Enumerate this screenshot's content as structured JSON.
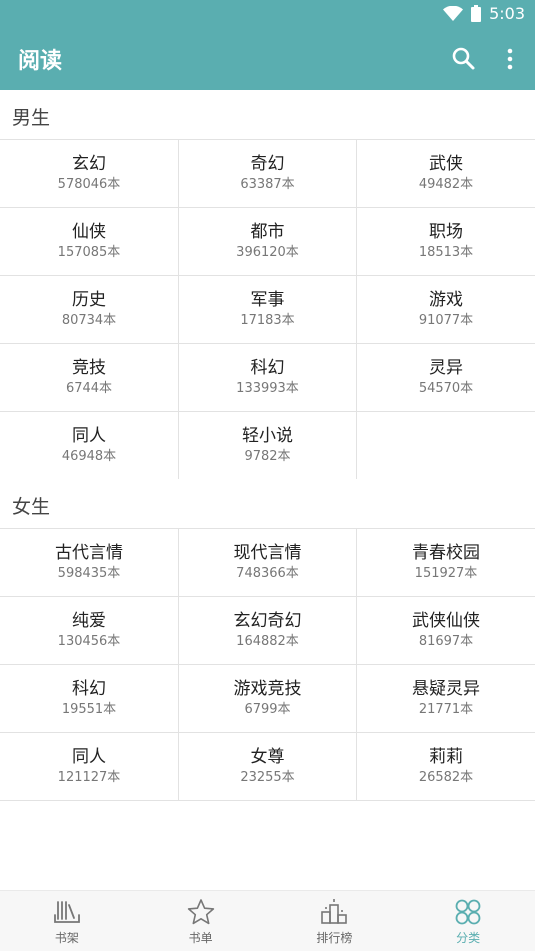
{
  "status": {
    "time": "5:03"
  },
  "appbar": {
    "title": "阅读",
    "search_icon": "search-icon",
    "more_icon": "more-vert-icon"
  },
  "sections": [
    {
      "title": "男生",
      "items": [
        {
          "name": "玄幻",
          "count": "578046本"
        },
        {
          "name": "奇幻",
          "count": "63387本"
        },
        {
          "name": "武侠",
          "count": "49482本"
        },
        {
          "name": "仙侠",
          "count": "157085本"
        },
        {
          "name": "都市",
          "count": "396120本"
        },
        {
          "name": "职场",
          "count": "18513本"
        },
        {
          "name": "历史",
          "count": "80734本"
        },
        {
          "name": "军事",
          "count": "17183本"
        },
        {
          "name": "游戏",
          "count": "91077本"
        },
        {
          "name": "竞技",
          "count": "6744本"
        },
        {
          "name": "科幻",
          "count": "133993本"
        },
        {
          "name": "灵异",
          "count": "54570本"
        },
        {
          "name": "同人",
          "count": "46948本"
        },
        {
          "name": "轻小说",
          "count": "9782本"
        }
      ]
    },
    {
      "title": "女生",
      "items": [
        {
          "name": "古代言情",
          "count": "598435本"
        },
        {
          "name": "现代言情",
          "count": "748366本"
        },
        {
          "name": "青春校园",
          "count": "151927本"
        },
        {
          "name": "纯爱",
          "count": "130456本"
        },
        {
          "name": "玄幻奇幻",
          "count": "164882本"
        },
        {
          "name": "武侠仙侠",
          "count": "81697本"
        },
        {
          "name": "科幻",
          "count": "19551本"
        },
        {
          "name": "游戏竞技",
          "count": "6799本"
        },
        {
          "name": "悬疑灵异",
          "count": "21771本"
        },
        {
          "name": "同人",
          "count": "121127本"
        },
        {
          "name": "女尊",
          "count": "23255本"
        },
        {
          "name": "莉莉",
          "count": "26582本"
        }
      ]
    }
  ],
  "bottom_nav": [
    {
      "label": "书架",
      "icon": "bookshelf-icon",
      "active": false
    },
    {
      "label": "书单",
      "icon": "star-icon",
      "active": false
    },
    {
      "label": "排行榜",
      "icon": "ranking-icon",
      "active": false
    },
    {
      "label": "分类",
      "icon": "category-icon",
      "active": true
    }
  ],
  "colors": {
    "primary": "#5aaeb0",
    "divider": "#e2e2e2",
    "text": "#222222",
    "subtext": "#777777"
  }
}
